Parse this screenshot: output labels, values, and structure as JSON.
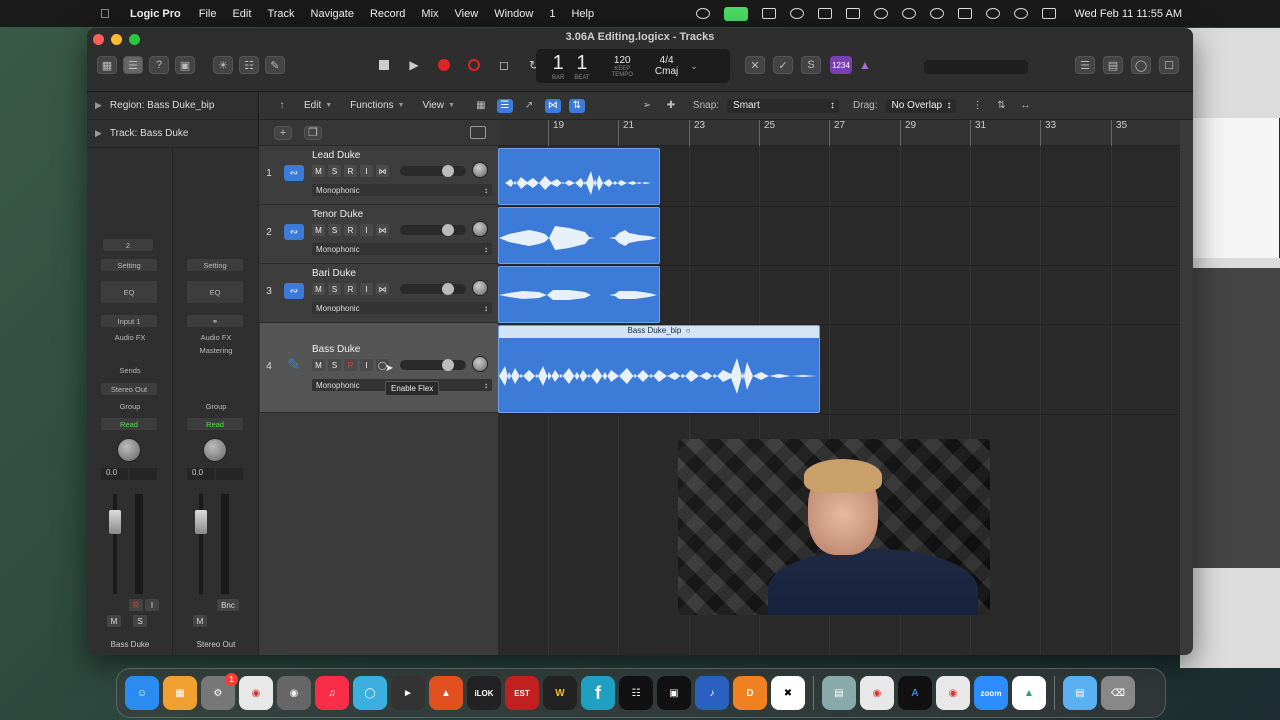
{
  "menubar": {
    "app": "Logic Pro",
    "menus": [
      "File",
      "Edit",
      "Track",
      "Navigate",
      "Record",
      "Mix",
      "View",
      "Window",
      "1",
      "Help"
    ],
    "clock": "Wed Feb 11  11:55 AM"
  },
  "window": {
    "title": "3.06A Editing.logicx - Tracks"
  },
  "lcd": {
    "bar": "1",
    "beat": "1",
    "bar_label": "BAR",
    "beat_label": "BEAT",
    "tempo": "120",
    "tempo_mode": "KEEP",
    "tempo_label": "TEMPO",
    "time_sig": "4/4",
    "key": "Cmaj"
  },
  "badge": "1234",
  "inspector": {
    "region_label": "Region:",
    "region_name": "Bass Duke_bip",
    "track_label": "Track:",
    "track_name": "Bass Duke",
    "strip1": {
      "num": "2",
      "setting": "Setting",
      "eq": "EQ",
      "input": "Input 1",
      "audio_fx": "Audio FX",
      "sends": "Sends",
      "output": "Stereo Out",
      "group": "Group",
      "automation": "Read",
      "vol": "0.0",
      "r": "R",
      "i": "I",
      "m": "M",
      "s": "S",
      "name": "Bass Duke"
    },
    "strip2": {
      "setting": "Setting",
      "eq": "EQ",
      "audio_fx": "Audio FX",
      "mastering": "Mastering",
      "group": "Group",
      "automation": "Read",
      "vol": "0.0",
      "bnc": "Bnc",
      "m": "M",
      "name": "Stereo Out"
    }
  },
  "toolbar": {
    "edit": "Edit",
    "functions": "Functions",
    "view": "View",
    "snap_label": "Snap:",
    "snap_value": "Smart",
    "drag_label": "Drag:",
    "drag_value": "No Overlap"
  },
  "tracks": [
    {
      "num": "1",
      "name": "Lead Duke",
      "mode": "Monophonic"
    },
    {
      "num": "2",
      "name": "Tenor Duke",
      "mode": "Monophonic"
    },
    {
      "num": "3",
      "name": "Bari Duke",
      "mode": "Monophonic"
    },
    {
      "num": "4",
      "name": "Bass Duke",
      "mode": "Monophonic"
    }
  ],
  "track_buttons": {
    "m": "M",
    "s": "S",
    "r": "R",
    "i": "I"
  },
  "tooltip": "Enable Flex",
  "ruler": [
    "19",
    "21",
    "23",
    "25",
    "27",
    "29",
    "31",
    "33",
    "35"
  ],
  "regions": {
    "bass_name": "Bass Duke_bip"
  },
  "dock": {
    "badge": "1",
    "zoom_label": "zoom",
    "ilok_label": "iLOK",
    "est_label": "EST"
  }
}
